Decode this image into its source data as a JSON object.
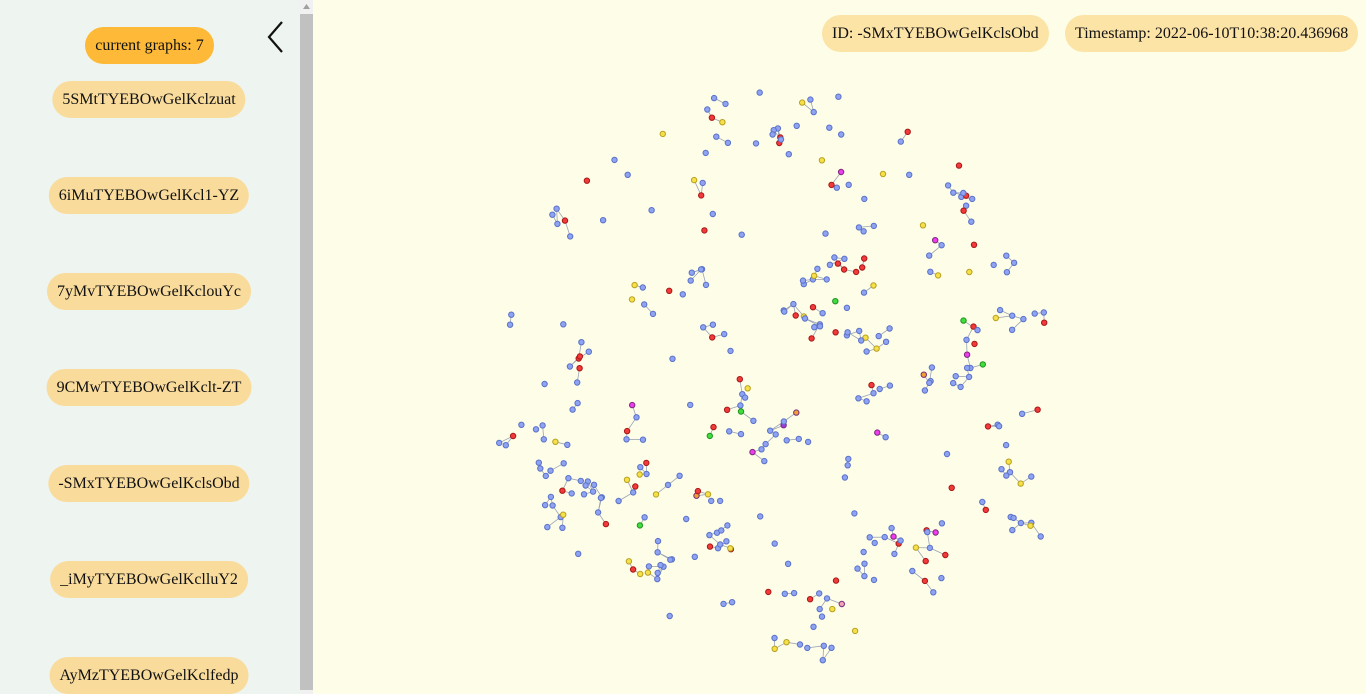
{
  "sidebar": {
    "count_label": "current graphs: 7",
    "collapse_icon": "chevron-left-icon",
    "graphs": [
      {
        "id": "5SMtTYEBOwGelKclzuat"
      },
      {
        "id": "6iMuTYEBOwGelKcl1-YZ"
      },
      {
        "id": "7yMvTYEBOwGelKclouYc"
      },
      {
        "id": "9CMwTYEBOwGelKclt-ZT"
      },
      {
        "id": "-SMxTYEBOwGelKclsObd"
      },
      {
        "id": "_iMyTYEBOwGelKclluY2"
      },
      {
        "id": "AyMzTYEBOwGelKclfedp"
      }
    ]
  },
  "header": {
    "id_label": "ID: -SMxTYEBOwGelKclsObd",
    "timestamp_label": "Timestamp: 2022-06-10T10:38:20.436968"
  },
  "colors": {
    "sidebar_bg": "#eef4ef",
    "canvas_bg": "#fefee8",
    "count_pill": "#fdb937",
    "graph_pill": "#f9db9c",
    "info_pill": "#fce3a6",
    "node_blue": "#8fa3f2",
    "node_red": "#f23a3a",
    "node_yellow": "#f5e04a",
    "node_green": "#3fdd3f",
    "node_magenta": "#ee3cee",
    "node_purple": "#9a3ce0",
    "node_orange": "#f0a030",
    "node_darkred": "#c40f0f",
    "node_pink": "#f4a2b8"
  }
}
